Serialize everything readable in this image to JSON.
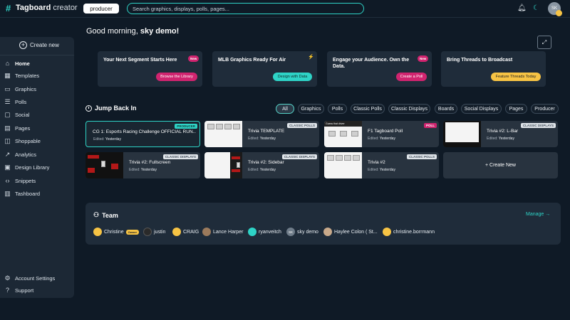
{
  "app": {
    "logo_text_bold": "Tagboard",
    "logo_text_light": "creator",
    "workspace": "producer",
    "search_placeholder": "Search graphics, displays, polls, pages...",
    "user_initials": "SK"
  },
  "sidebar": {
    "create_new": "Create new",
    "items": [
      {
        "label": "Home",
        "icon": "home-icon"
      },
      {
        "label": "Templates",
        "icon": "templates-icon"
      },
      {
        "label": "Graphics",
        "icon": "graphics-icon"
      },
      {
        "label": "Polls",
        "icon": "polls-icon"
      },
      {
        "label": "Social",
        "icon": "social-icon"
      },
      {
        "label": "Pages",
        "icon": "pages-icon"
      },
      {
        "label": "Shoppable",
        "icon": "shoppable-icon"
      },
      {
        "label": "Analytics",
        "icon": "analytics-icon"
      },
      {
        "label": "Design Library",
        "icon": "design-library-icon"
      },
      {
        "label": "Snippets",
        "icon": "snippets-icon"
      },
      {
        "label": "Tashboard",
        "icon": "tashboard-icon"
      }
    ],
    "bottom": [
      {
        "label": "Account Settings",
        "icon": "settings-icon"
      },
      {
        "label": "Support",
        "icon": "help-icon"
      }
    ]
  },
  "main": {
    "greeting_prefix": "Good morning,",
    "greeting_name": "sky demo!",
    "promos": [
      {
        "title": "Your Next Segment Starts Here",
        "button": "Browse the Library",
        "badge": "New",
        "button_color": "#d0246f"
      },
      {
        "title": "MLB Graphics Ready For Air",
        "button": "Design with Data",
        "badge": "⚡",
        "button_color": "#2ed3c6"
      },
      {
        "title": "Engage your Audience. Own the Data.",
        "button": "Create a Poll",
        "badge": "New",
        "button_color": "#d0246f"
      },
      {
        "title": "Bring Threads to Broadcast",
        "button": "Feature Threads Today",
        "badge": "",
        "button_color": "#f6c344"
      }
    ],
    "jump_back_title": "Jump Back In",
    "filters": [
      "All",
      "Graphics",
      "Polls",
      "Classic Polls",
      "Classic Displays",
      "Boards",
      "Social Displays",
      "Pages",
      "Producer"
    ],
    "edited_label": "Edited:",
    "cards": [
      {
        "title": "CG 1: Esports Racing Challenge OFFICIAL RUN...",
        "edited": "Yesterday",
        "tag": "PRODUCER"
      },
      {
        "title": "Trivia TEMPLATE",
        "edited": "Yesterday",
        "tag": "CLASSIC POLLS"
      },
      {
        "title": "F1 Tagboard Poll",
        "edited": "Yesterday",
        "tag": "POLL"
      },
      {
        "title": "Trivia #2: L-Bar",
        "edited": "Yesterday",
        "tag": "CLASSIC DISPLAYS"
      },
      {
        "title": "Trivia #2: Fullscreen",
        "edited": "Yesterday",
        "tag": "CLASSIC DISPLAYS"
      },
      {
        "title": "Trivia #2: Sidebar",
        "edited": "Yesterday",
        "tag": "CLASSIC DISPLAYS"
      },
      {
        "title": "Trivia #2",
        "edited": "Yesterday",
        "tag": "CLASSIC POLLS"
      }
    ],
    "create_new_card": "+ Create New",
    "thumb_text": "Guess that driver"
  },
  "team": {
    "title": "Team",
    "manage": "Manage →",
    "owner_badge": "Owner",
    "members": [
      {
        "name": "Christine",
        "initials": "",
        "color": "#f6c344"
      },
      {
        "name": "justin",
        "initials": "",
        "color": "#2a2a2a"
      },
      {
        "name": "CRAIG",
        "initials": "",
        "color": "#f6c344"
      },
      {
        "name": "Lance Harper",
        "initials": "",
        "color": "#9b7a5c"
      },
      {
        "name": "ryanveitch",
        "initials": "",
        "color": "#2ed3c6"
      },
      {
        "name": "sky demo",
        "initials": "SK",
        "color": "#6f7c89"
      },
      {
        "name": "Haylee Colon ( St...",
        "initials": "",
        "color": "#c8a98a"
      },
      {
        "name": "christine.borrmann",
        "initials": "",
        "color": "#f6c344"
      }
    ]
  }
}
